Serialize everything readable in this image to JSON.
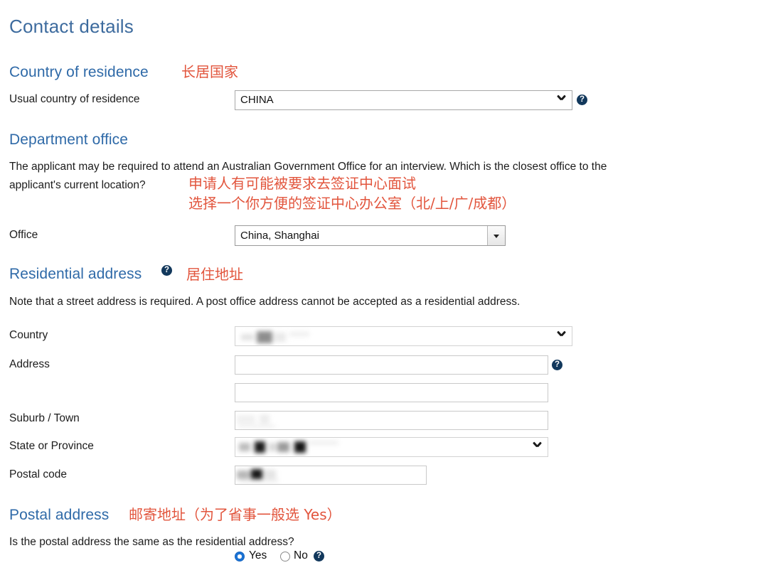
{
  "page": {
    "title": "Contact details"
  },
  "sections": {
    "country_of_residence": {
      "heading": "Country of residence",
      "annotation": "长居国家",
      "field_label": "Usual country of residence",
      "field_value": "CHINA",
      "help_icon": "help-question-icon"
    },
    "department_office": {
      "heading": "Department office",
      "paragraph_line1": "The applicant may be required to attend an Australian Government Office for an interview. Which is the closest office to the",
      "paragraph_line2": "applicant's current location?",
      "annotation_line1": "申请人有可能被要求去签证中心面试",
      "annotation_line2": "选择一个你方便的签证中心办公室（北/上/广/成都）",
      "field_label": "Office",
      "field_value": "China, Shanghai"
    },
    "residential_address": {
      "heading": "Residential address",
      "annotation": "居住地址",
      "note": "Note that a street address is required. A post office address cannot be accepted as a residential address.",
      "fields": [
        {
          "label": "Country",
          "value": "",
          "redacted": true,
          "type": "select"
        },
        {
          "label": "Address",
          "value": "",
          "redacted": false,
          "type": "text"
        },
        {
          "label": "",
          "value": "",
          "redacted": false,
          "type": "text"
        },
        {
          "label": "Suburb / Town",
          "value": "",
          "redacted": true,
          "type": "text"
        },
        {
          "label": "State or Province",
          "value": "",
          "redacted": true,
          "type": "select"
        },
        {
          "label": "Postal code",
          "value": "",
          "redacted": true,
          "type": "text"
        }
      ]
    },
    "postal_address": {
      "heading": "Postal address",
      "annotation": "邮寄地址（为了省事一般选 Yes）",
      "question": "Is the postal address the same as the residential address?",
      "options": [
        {
          "label": "Yes",
          "selected": true
        },
        {
          "label": "No",
          "selected": false
        }
      ]
    }
  },
  "colors": {
    "heading_blue": "#2f6aa8",
    "title_blue": "#3d6b9e",
    "annotation_red": "#e2553d",
    "help_navy": "#12385c",
    "radio_blue": "#1b73d4",
    "background": "#ffffff"
  }
}
